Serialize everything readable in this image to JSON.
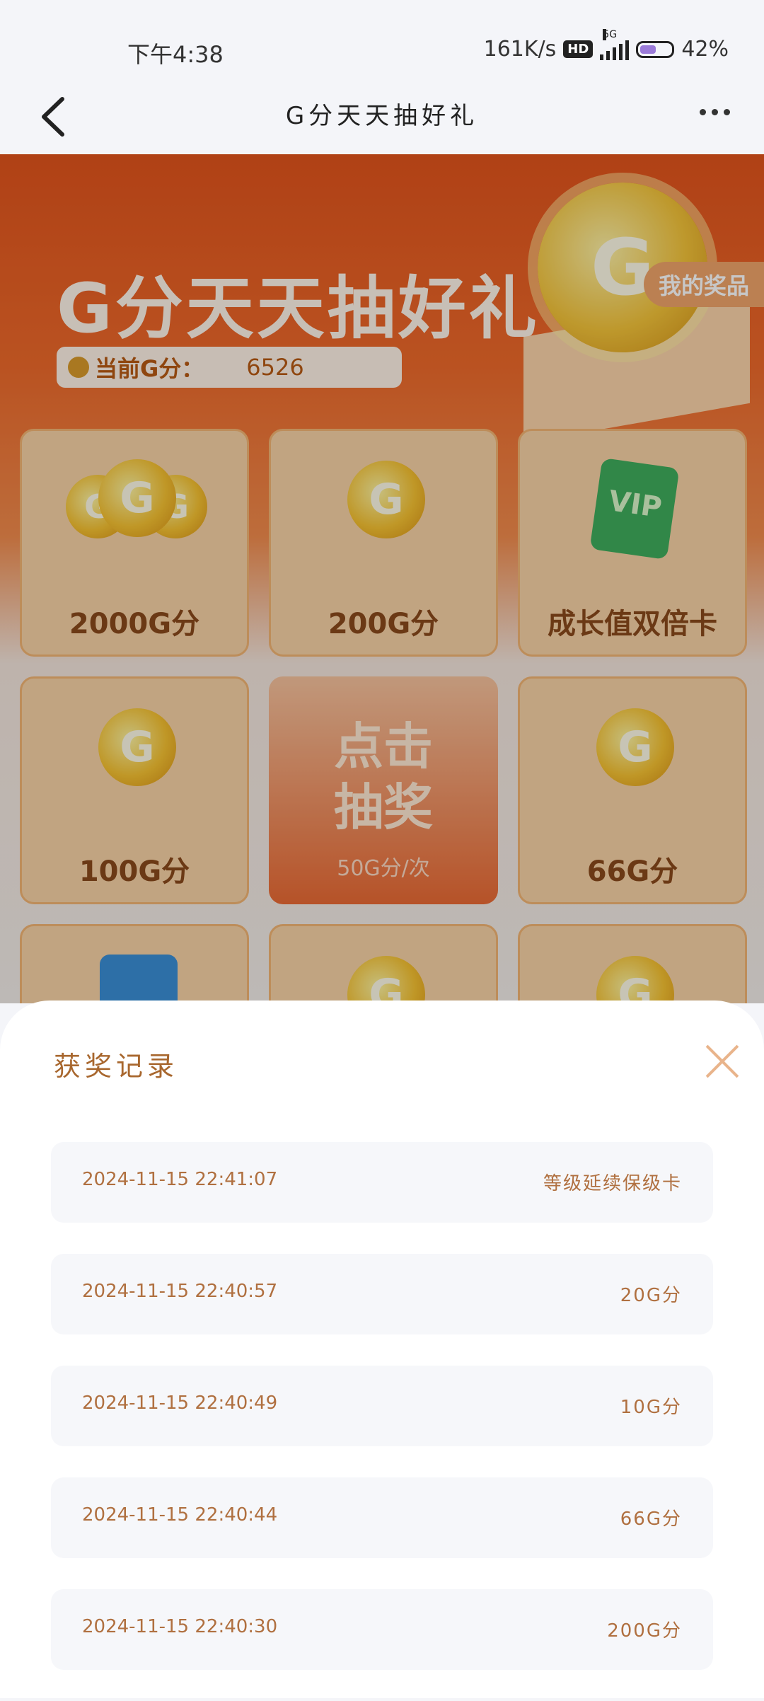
{
  "status_bar": {
    "time": "下午4:38",
    "network_speed": "161K/s",
    "hd": "HD",
    "signal": "5G",
    "battery": "42%"
  },
  "nav": {
    "title": "G分天天抽好礼",
    "back_icon": "chevron-left-icon",
    "more_icon": "more-dots-icon"
  },
  "hero": {
    "title": "G分天天抽好礼",
    "points_label": "当前G分：",
    "points_value": "6526",
    "my_prizes": "我的奖品"
  },
  "prize_grid": {
    "tiles": [
      {
        "label": "2000G分",
        "icon": "coin-stack-icon"
      },
      {
        "label": "200G分",
        "icon": "coin-icon"
      },
      {
        "label": "成长值双倍卡",
        "icon": "vip-card-icon"
      },
      {
        "label": "100G分",
        "icon": "coin-icon"
      },
      {
        "label": "66G分",
        "icon": "coin-icon"
      }
    ],
    "draw_button": {
      "line1": "点击",
      "line2": "抽奖",
      "cost": "50G分/次"
    }
  },
  "sheet": {
    "title": "获奖记录",
    "records": [
      {
        "time": "2024-11-15 22:41:07",
        "prize": "等级延续保级卡"
      },
      {
        "time": "2024-11-15 22:40:57",
        "prize": "20G分"
      },
      {
        "time": "2024-11-15 22:40:49",
        "prize": "10G分"
      },
      {
        "time": "2024-11-15 22:40:44",
        "prize": "66G分"
      },
      {
        "time": "2024-11-15 22:40:30",
        "prize": "200G分"
      }
    ]
  }
}
